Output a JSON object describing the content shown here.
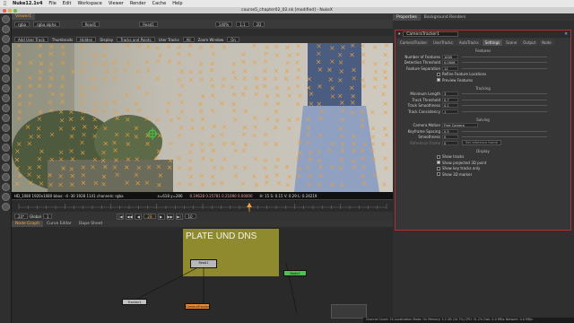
{
  "menubar": {
    "app": "Nuke12.1v4",
    "items": [
      "File",
      "Edit",
      "Workspace",
      "Viewer",
      "Render",
      "Cache",
      "Help"
    ]
  },
  "window": {
    "title": "course5_chapter02_02.nk [modified] - NukeX"
  },
  "viewer": {
    "tab": "Viewer1",
    "layer": "rgba",
    "channel": "rgba.alpha",
    "dropdown_a": "Read1",
    "dropdown_b": "Read1",
    "zoom": "140%",
    "ratio": "1:1",
    "mode_2d": "2D",
    "overlay_add": "Add User Track",
    "thumbnails_label": "Thumbnails",
    "thumbnails_value": "Hidden",
    "display_label": "Display",
    "display_value": "Tracks and Points",
    "user_tracks_label": "User Tracks",
    "user_tracks_value": "All",
    "zoom_window_label": "Zoom Window",
    "zoom_window_value": "On",
    "info_left": "HD_1080 1920x1080  bbox: -4 -30 1928 1141  channels: rgba",
    "info_coords": "x=618 y=286",
    "info_values": "0.19628  0.25781  0.21090  0.00000",
    "info_hsl": "H: 15 S: 0.15 V: 0.29  L: 0.24219",
    "fps": "24*",
    "frame_start": "1",
    "frame_current": "28",
    "frame_end": "10",
    "global_label": "Global"
  },
  "nodegraph": {
    "tabs": [
      "Node Graph",
      "Curve Editor",
      "Dope Sheet"
    ],
    "backdrop_title": "PLATE UND DNS",
    "nodes": {
      "read": "Read1",
      "tracker": "Tracker1",
      "camtracker": "CameraTracker1",
      "green": "Node1"
    }
  },
  "properties": {
    "tabs": [
      "Properties",
      "Background Renders"
    ],
    "node_name": "CameraTracker1",
    "panel_tabs": [
      "CameraTracker",
      "UserTracks",
      "AutoTracks",
      "Settings",
      "Scene",
      "Output",
      "Node"
    ],
    "active_tab": "Settings",
    "features_header": "Features",
    "tracking_header": "Tracking",
    "solving_header": "Solving",
    "display_header": "Display",
    "features": [
      {
        "label": "Number of Features",
        "value": "1000"
      },
      {
        "label": "Detection Threshold",
        "value": "0.0006"
      },
      {
        "label": "Feature Separation",
        "value": "12"
      }
    ],
    "feature_checks": [
      {
        "label": "Refine Feature Locations",
        "on": false
      },
      {
        "label": "Preview Features",
        "on": true
      }
    ],
    "tracking": [
      {
        "label": "Minimum Length",
        "value": "3"
      },
      {
        "label": "Track Threshold",
        "value": "0.7"
      },
      {
        "label": "Track Smoothness",
        "value": "0.1"
      },
      {
        "label": "Track Consistency",
        "value": "1"
      }
    ],
    "solving": {
      "camera_motion_label": "Camera Motion",
      "camera_motion_value": "Free Camera",
      "keyframe_spacing_label": "Keyframe Spacing",
      "keyframe_spacing_value": "0.5",
      "smoothness_label": "Smoothness",
      "smoothness_value": "0",
      "ref_frame_label": "Reference Frame",
      "ref_frame_value": "0",
      "set_ref_button": "Set reference frame"
    },
    "display_checks": [
      {
        "label": "Show tracks",
        "on": false
      },
      {
        "label": "Show projected 3D point",
        "on": true
      },
      {
        "label": "Show key tracks only",
        "on": false
      },
      {
        "label": "Show 3D marker",
        "on": false
      }
    ]
  },
  "statusbar": {
    "text": "Channel Count: 20  Localization Mode: On  Memory: 3.2 GB (10.7%)  CPU: 31.2%  Disk: 0.0 MB/s  Network: 0.0 MB/s"
  },
  "colors": {
    "accent": "#f2a23a",
    "marker": "#e8a040",
    "panel_border": "#b03030",
    "backdrop": "#8f8a2d"
  }
}
